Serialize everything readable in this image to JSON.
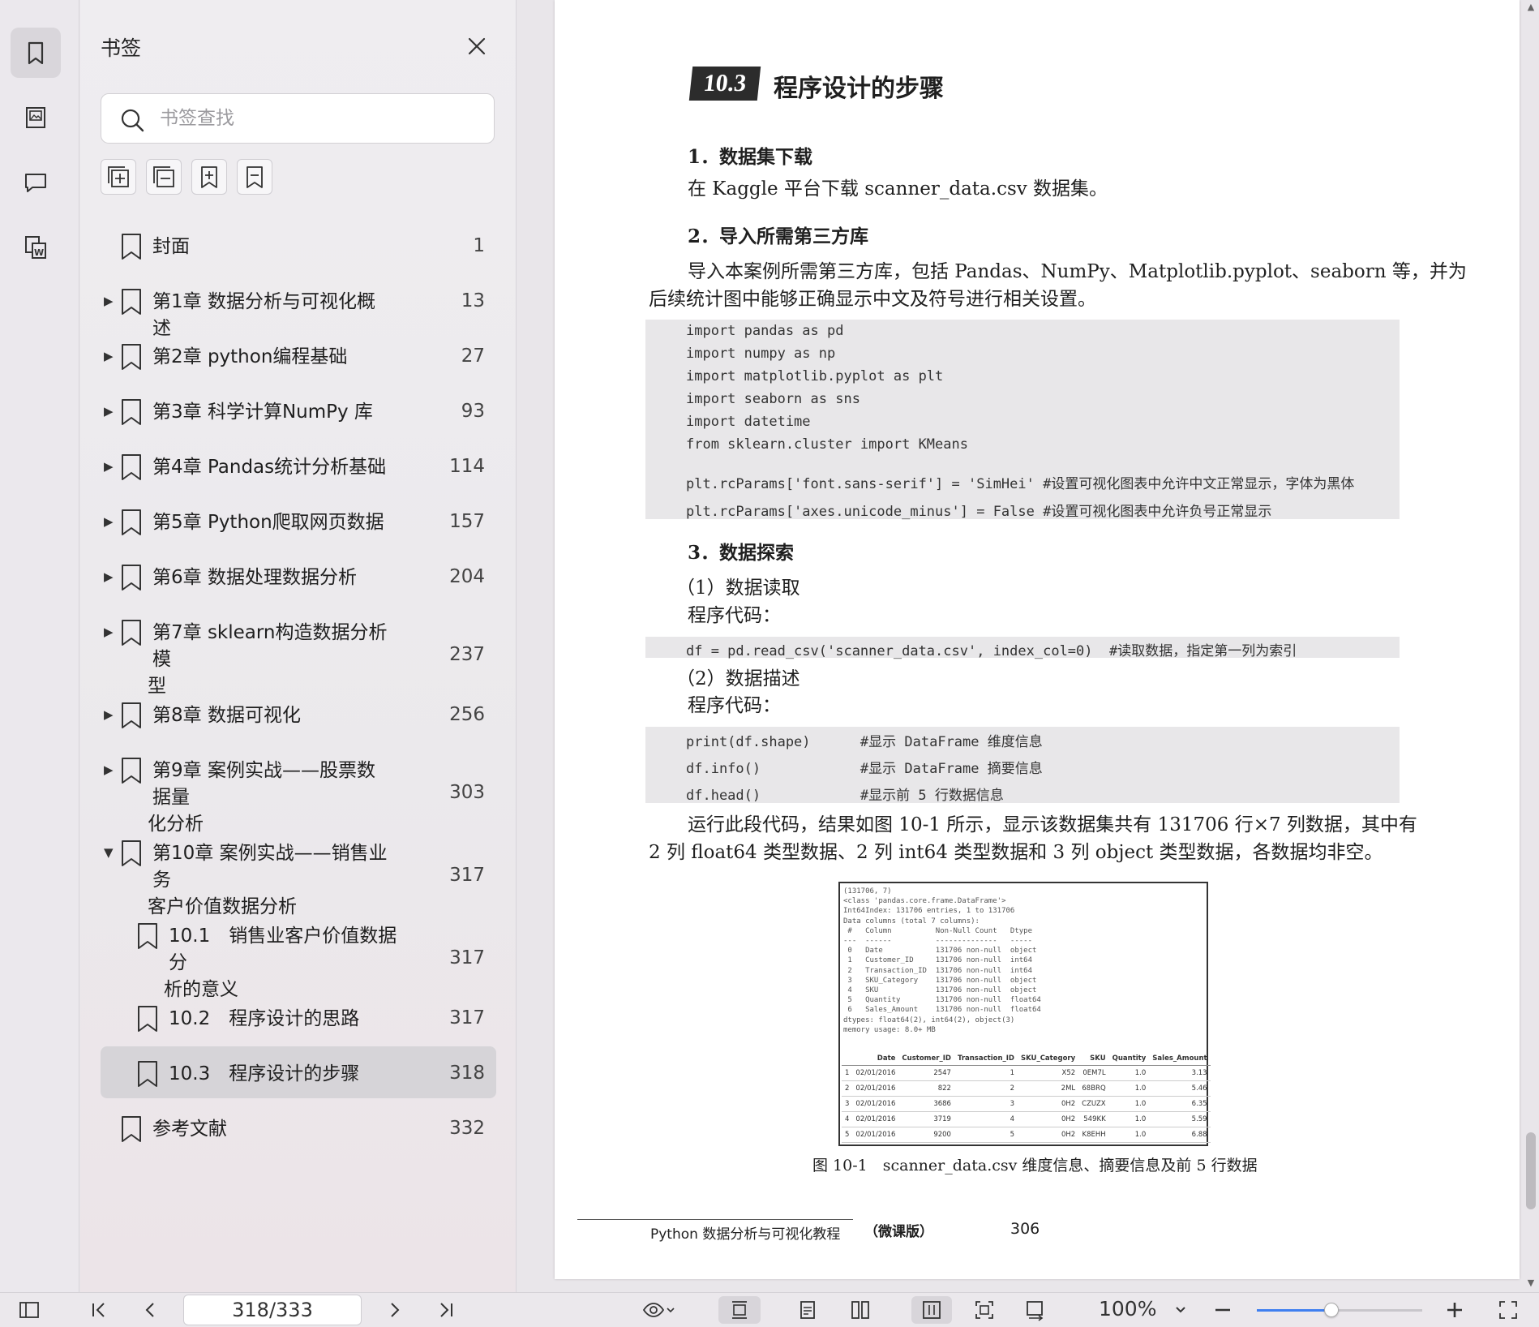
{
  "rail": {
    "icons": [
      "bookmark-icon",
      "thumbnail-icon",
      "comment-icon",
      "word-convert-icon"
    ]
  },
  "panel": {
    "title": "书签",
    "search_placeholder": "书签查找",
    "bookmarks": [
      {
        "label": "封面",
        "page": "1"
      },
      {
        "label": "第1章 数据分析与可视化概述",
        "page": "13"
      },
      {
        "label": "第2章 python编程基础",
        "page": "27"
      },
      {
        "label": "第3章 科学计算NumPy 库",
        "page": "93"
      },
      {
        "label": "第4章 Pandas统计分析基础",
        "page": "114"
      },
      {
        "label": "第5章 Python爬取网页数据",
        "page": "157"
      },
      {
        "label": "第6章 数据处理数据分析",
        "page": "204"
      },
      {
        "label": "第7章 sklearn构造数据分析模",
        "label2": "型",
        "page": "237"
      },
      {
        "label": "第8章 数据可视化",
        "page": "256"
      },
      {
        "label": "第9章 案例实战——股票数据量",
        "label2": "化分析",
        "page": "303"
      },
      {
        "label": "第10章 案例实战——销售业务",
        "label2": "客户价值数据分析",
        "page": "317"
      },
      {
        "label": "10.1　销售业客户价值数据分",
        "label2": "析的意义",
        "page": "317"
      },
      {
        "label": "10.2　程序设计的思路",
        "page": "317"
      },
      {
        "label": "10.3　程序设计的步骤",
        "page": "318"
      },
      {
        "label": "参考文献",
        "page": "332"
      }
    ]
  },
  "doc": {
    "section_number": "10.3",
    "section_title": "程序设计的步骤",
    "h1": "1．数据集下载",
    "p1": "在 Kaggle 平台下载 scanner_data.csv 数据集。",
    "h2": "2．导入所需第三方库",
    "p2a": "导入本案例所需第三方库，包括 Pandas、NumPy、Matplotlib.pyplot、seaborn 等，并为",
    "p2b": "后续统计图中能够正确显示中文及符号进行相关设置。",
    "code1": [
      "import pandas as pd",
      "import numpy as np",
      "import matplotlib.pyplot as plt",
      "import seaborn as sns",
      "import datetime",
      "from sklearn.cluster import KMeans",
      "plt.rcParams['font.sans-serif'] = 'SimHei' #设置可视化图表中允许中文正常显示，字体为黑体",
      "plt.rcParams['axes.unicode_minus'] = False #设置可视化图表中允许负号正常显示"
    ],
    "h3": "3．数据探索",
    "sub1": "（1）数据读取",
    "code_label1": "程序代码：",
    "code2": "df = pd.read_csv('scanner_data.csv', index_col=0)  #读取数据，指定第一列为索引",
    "sub2": "（2）数据描述",
    "code_label2": "程序代码：",
    "code3": [
      "print(df.shape)      #显示 DataFrame 维度信息",
      "df.info()            #显示 DataFrame 摘要信息",
      "df.head()            #显示前 5 行数据信息"
    ],
    "p3a": "运行此段代码，结果如图 10-1 所示，显示该数据集共有 131706 行×7 列数据，其中有",
    "p3b": "2 列 float64 类型数据、2 列 int64 类型数据和 3 列 object 类型数据，各数据均非空。",
    "figure_info": "(131706, 7)\n<class 'pandas.core.frame.DataFrame'>\nInt64Index: 131706 entries, 1 to 131706\nData columns (total 7 columns):\n #   Column          Non-Null Count   Dtype\n---  ------          --------------   -----\n 0   Date            131706 non-null  object\n 1   Customer_ID     131706 non-null  int64\n 2   Transaction_ID  131706 non-null  int64\n 3   SKU_Category    131706 non-null  object\n 4   SKU             131706 non-null  object\n 5   Quantity        131706 non-null  float64\n 6   Sales_Amount    131706 non-null  float64\ndtypes: float64(2), int64(2), object(3)\nmemory usage: 8.0+ MB",
    "figure_table": {
      "headers": [
        "",
        "Date",
        "Customer_ID",
        "Transaction_ID",
        "SKU_Category",
        "SKU",
        "Quantity",
        "Sales_Amount"
      ],
      "rows": [
        [
          "1",
          "02/01/2016",
          "2547",
          "1",
          "X52",
          "0EM7L",
          "1.0",
          "3.13"
        ],
        [
          "2",
          "02/01/2016",
          "822",
          "2",
          "2ML",
          "68BRQ",
          "1.0",
          "5.46"
        ],
        [
          "3",
          "02/01/2016",
          "3686",
          "3",
          "0H2",
          "CZUZX",
          "1.0",
          "6.35"
        ],
        [
          "4",
          "02/01/2016",
          "3719",
          "4",
          "0H2",
          "549KK",
          "1.0",
          "5.59"
        ],
        [
          "5",
          "02/01/2016",
          "9200",
          "5",
          "0H2",
          "K8EHH",
          "1.0",
          "6.88"
        ]
      ]
    },
    "figure_caption": "图 10-1　scanner_data.csv 维度信息、摘要信息及前 5 行数据",
    "footer_book": "Python 数据分析与可视化教程",
    "footer_edition": "（微课版）",
    "footer_page": "306"
  },
  "bottombar": {
    "page_indicator": "318/333",
    "zoom": "100%",
    "zoom_fraction": 0.45
  }
}
